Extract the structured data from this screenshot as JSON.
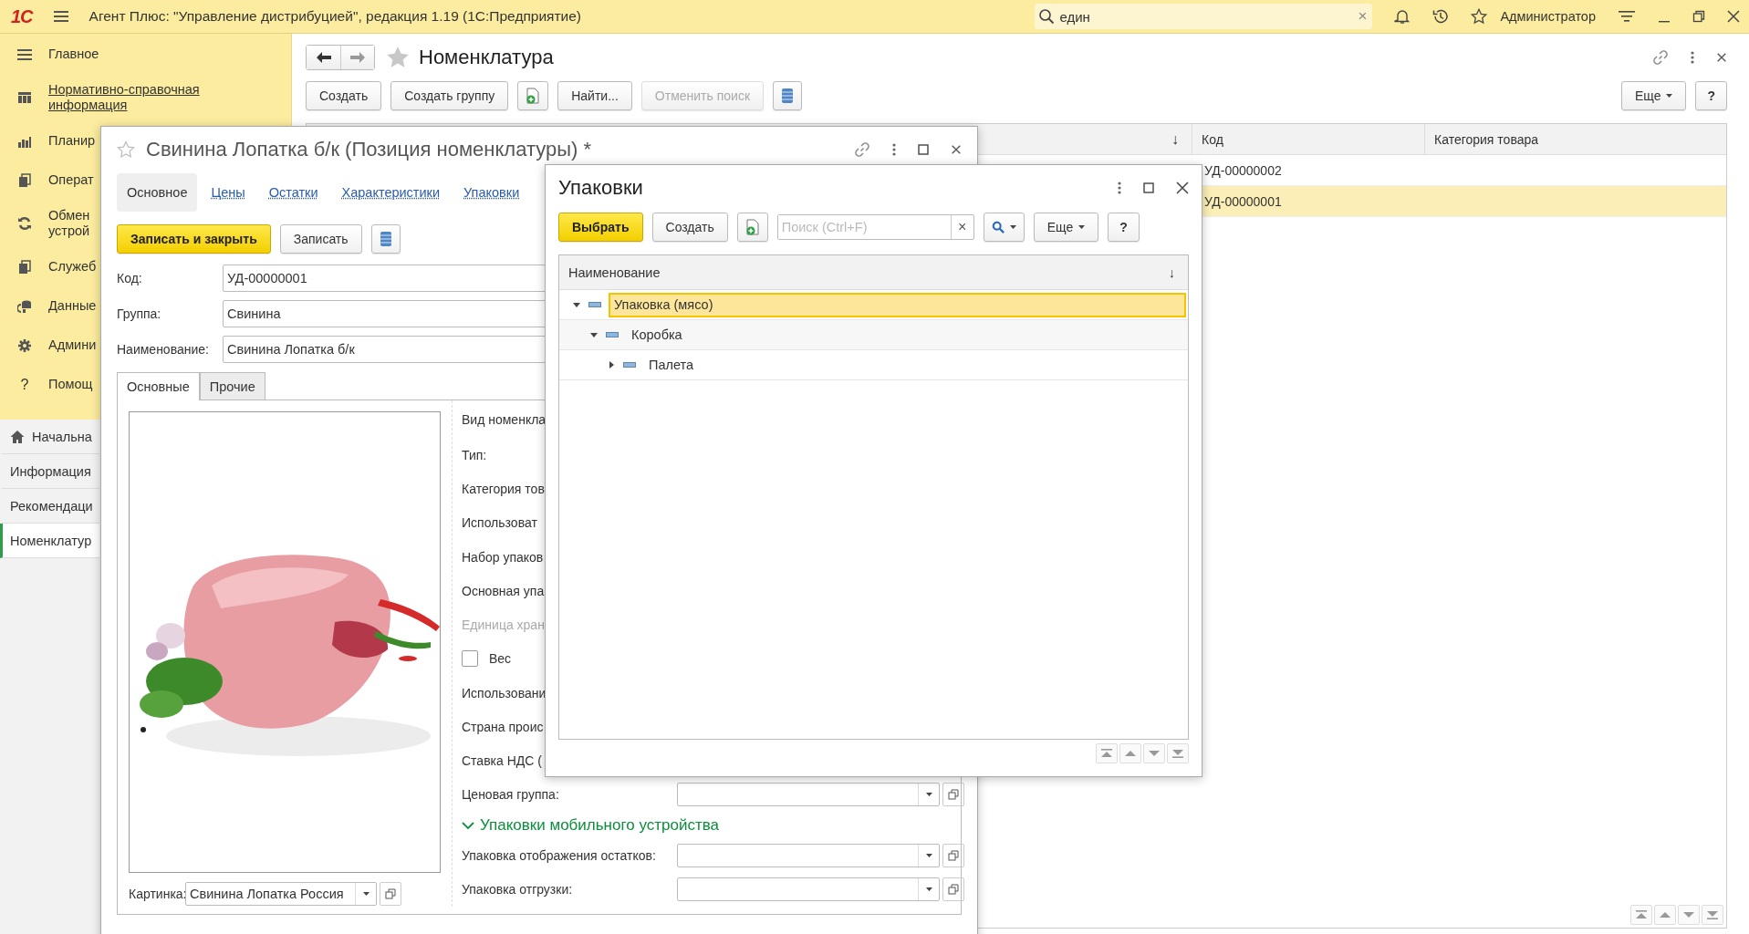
{
  "app": {
    "logo": "1С",
    "title": "Агент Плюс: \"Управление дистрибуцией\", редакция 1.19 (1С:Предприятие)",
    "search": {
      "value": "един",
      "clear": "×"
    },
    "user": "Администратор"
  },
  "sidebar": {
    "sections": [
      {
        "lines": [
          "Главное"
        ],
        "selected": false
      },
      {
        "lines": [
          "Нормативно-справочная",
          "информация"
        ],
        "selected": true
      },
      {
        "lines": [
          "Планир"
        ],
        "selected": false
      },
      {
        "lines": [
          "Операт"
        ],
        "selected": false
      },
      {
        "lines": [
          "Обмен",
          "устрой"
        ],
        "selected": false
      },
      {
        "lines": [
          "Служеб"
        ],
        "selected": false
      },
      {
        "lines": [
          "Данные"
        ],
        "selected": false
      },
      {
        "lines": [
          "Админи"
        ],
        "selected": false
      },
      {
        "lines": [
          "Помощ"
        ],
        "selected": false,
        "glyph": "?"
      }
    ],
    "nav": [
      {
        "label": "Начальна",
        "selected": false
      },
      {
        "label": "Информация",
        "selected": false
      },
      {
        "label": "Рекомендаци",
        "selected": false
      },
      {
        "label": "Номенклатур",
        "selected": true
      }
    ]
  },
  "main": {
    "title": "Номенклатура",
    "toolbar": [
      {
        "kind": "text",
        "label": "Создать",
        "disabled": false
      },
      {
        "kind": "text",
        "label": "Создать группу",
        "disabled": false
      },
      {
        "kind": "add",
        "disabled": false
      },
      {
        "kind": "text",
        "label": "Найти...",
        "disabled": false
      },
      {
        "kind": "text",
        "label": "Отменить поиск",
        "disabled": true
      },
      {
        "kind": "list",
        "disabled": false
      }
    ],
    "more": "Еще",
    "help": "?",
    "table": {
      "columns": [
        {
          "sort_mark": "↓"
        },
        {
          "label": "Код"
        },
        {
          "label": "Категория товара"
        }
      ],
      "rows": [
        {
          "code": "УД-00000002",
          "selected": false
        },
        {
          "code": "УД-00000001",
          "selected": true
        }
      ]
    }
  },
  "form": {
    "title": "Свинина Лопатка б/к (Позиция номенклатуры) *",
    "tabs": [
      {
        "label": "Основное",
        "selected": true
      },
      {
        "label": "Цены",
        "selected": false
      },
      {
        "label": "Остатки",
        "selected": false
      },
      {
        "label": "Характеристики",
        "selected": false
      },
      {
        "label": "Упаковки",
        "selected": false
      }
    ],
    "actions": [
      {
        "kind": "primary",
        "label": "Записать и закрыть"
      },
      {
        "kind": "text",
        "label": "Записать"
      },
      {
        "kind": "list"
      }
    ],
    "fields": [
      {
        "label": "Код:",
        "value": "УД-00000001"
      },
      {
        "label": "Группа:",
        "value": "Свинина"
      },
      {
        "label": "Наименование:",
        "value": "Свинина Лопатка б/к"
      }
    ],
    "inner_tabs": [
      {
        "label": "Основные",
        "selected": true
      },
      {
        "label": "Прочие",
        "selected": false
      }
    ],
    "picture_field": {
      "label": "Картинка:",
      "value": "Свинина Лопатка Россия"
    },
    "properties": [
      {
        "kind": "label",
        "label": "Вид номенкла",
        "disabled": false
      },
      {
        "kind": "label",
        "label": "Тип:",
        "disabled": false
      },
      {
        "kind": "label",
        "label": "Категория тов",
        "disabled": false
      },
      {
        "kind": "label",
        "label": "Использоват",
        "disabled": false
      },
      {
        "kind": "label",
        "label": "Набор упаков",
        "disabled": false
      },
      {
        "kind": "label",
        "label": "Основная упа",
        "disabled": false
      },
      {
        "kind": "label",
        "label": "Единица хран",
        "disabled": true
      },
      {
        "kind": "checkbox",
        "label": "Вес",
        "checked": false
      },
      {
        "kind": "label",
        "label": "Использовани",
        "disabled": false
      },
      {
        "kind": "label",
        "label": "Страна проис",
        "disabled": false
      },
      {
        "kind": "label",
        "label": "Ставка НДС (",
        "disabled": false
      },
      {
        "kind": "select",
        "label": "Ценовая группа:"
      }
    ],
    "mobile_section": {
      "title": "Упаковки мобильного устройства",
      "expanded": true,
      "fields": [
        {
          "label": "Упаковка отображения остатков:"
        },
        {
          "label": "Упаковка отгрузки:"
        }
      ]
    }
  },
  "dialog": {
    "title": "Упаковки",
    "actions": [
      {
        "kind": "primary",
        "label": "Выбрать"
      },
      {
        "kind": "text",
        "label": "Создать"
      },
      {
        "kind": "add"
      }
    ],
    "search": {
      "placeholder": "Поиск (Ctrl+F)",
      "clear": "×"
    },
    "more": "Еще",
    "help": "?",
    "column": {
      "label": "Наименование",
      "sort_mark": "↓"
    },
    "tree": [
      {
        "label": "Упаковка (мясо)",
        "selected": true,
        "expanded": true,
        "children": [
          {
            "label": "Коробка",
            "selected": false,
            "expanded": true,
            "children": [
              {
                "label": "Палета",
                "selected": false,
                "expanded": false
              }
            ]
          }
        ]
      }
    ]
  }
}
